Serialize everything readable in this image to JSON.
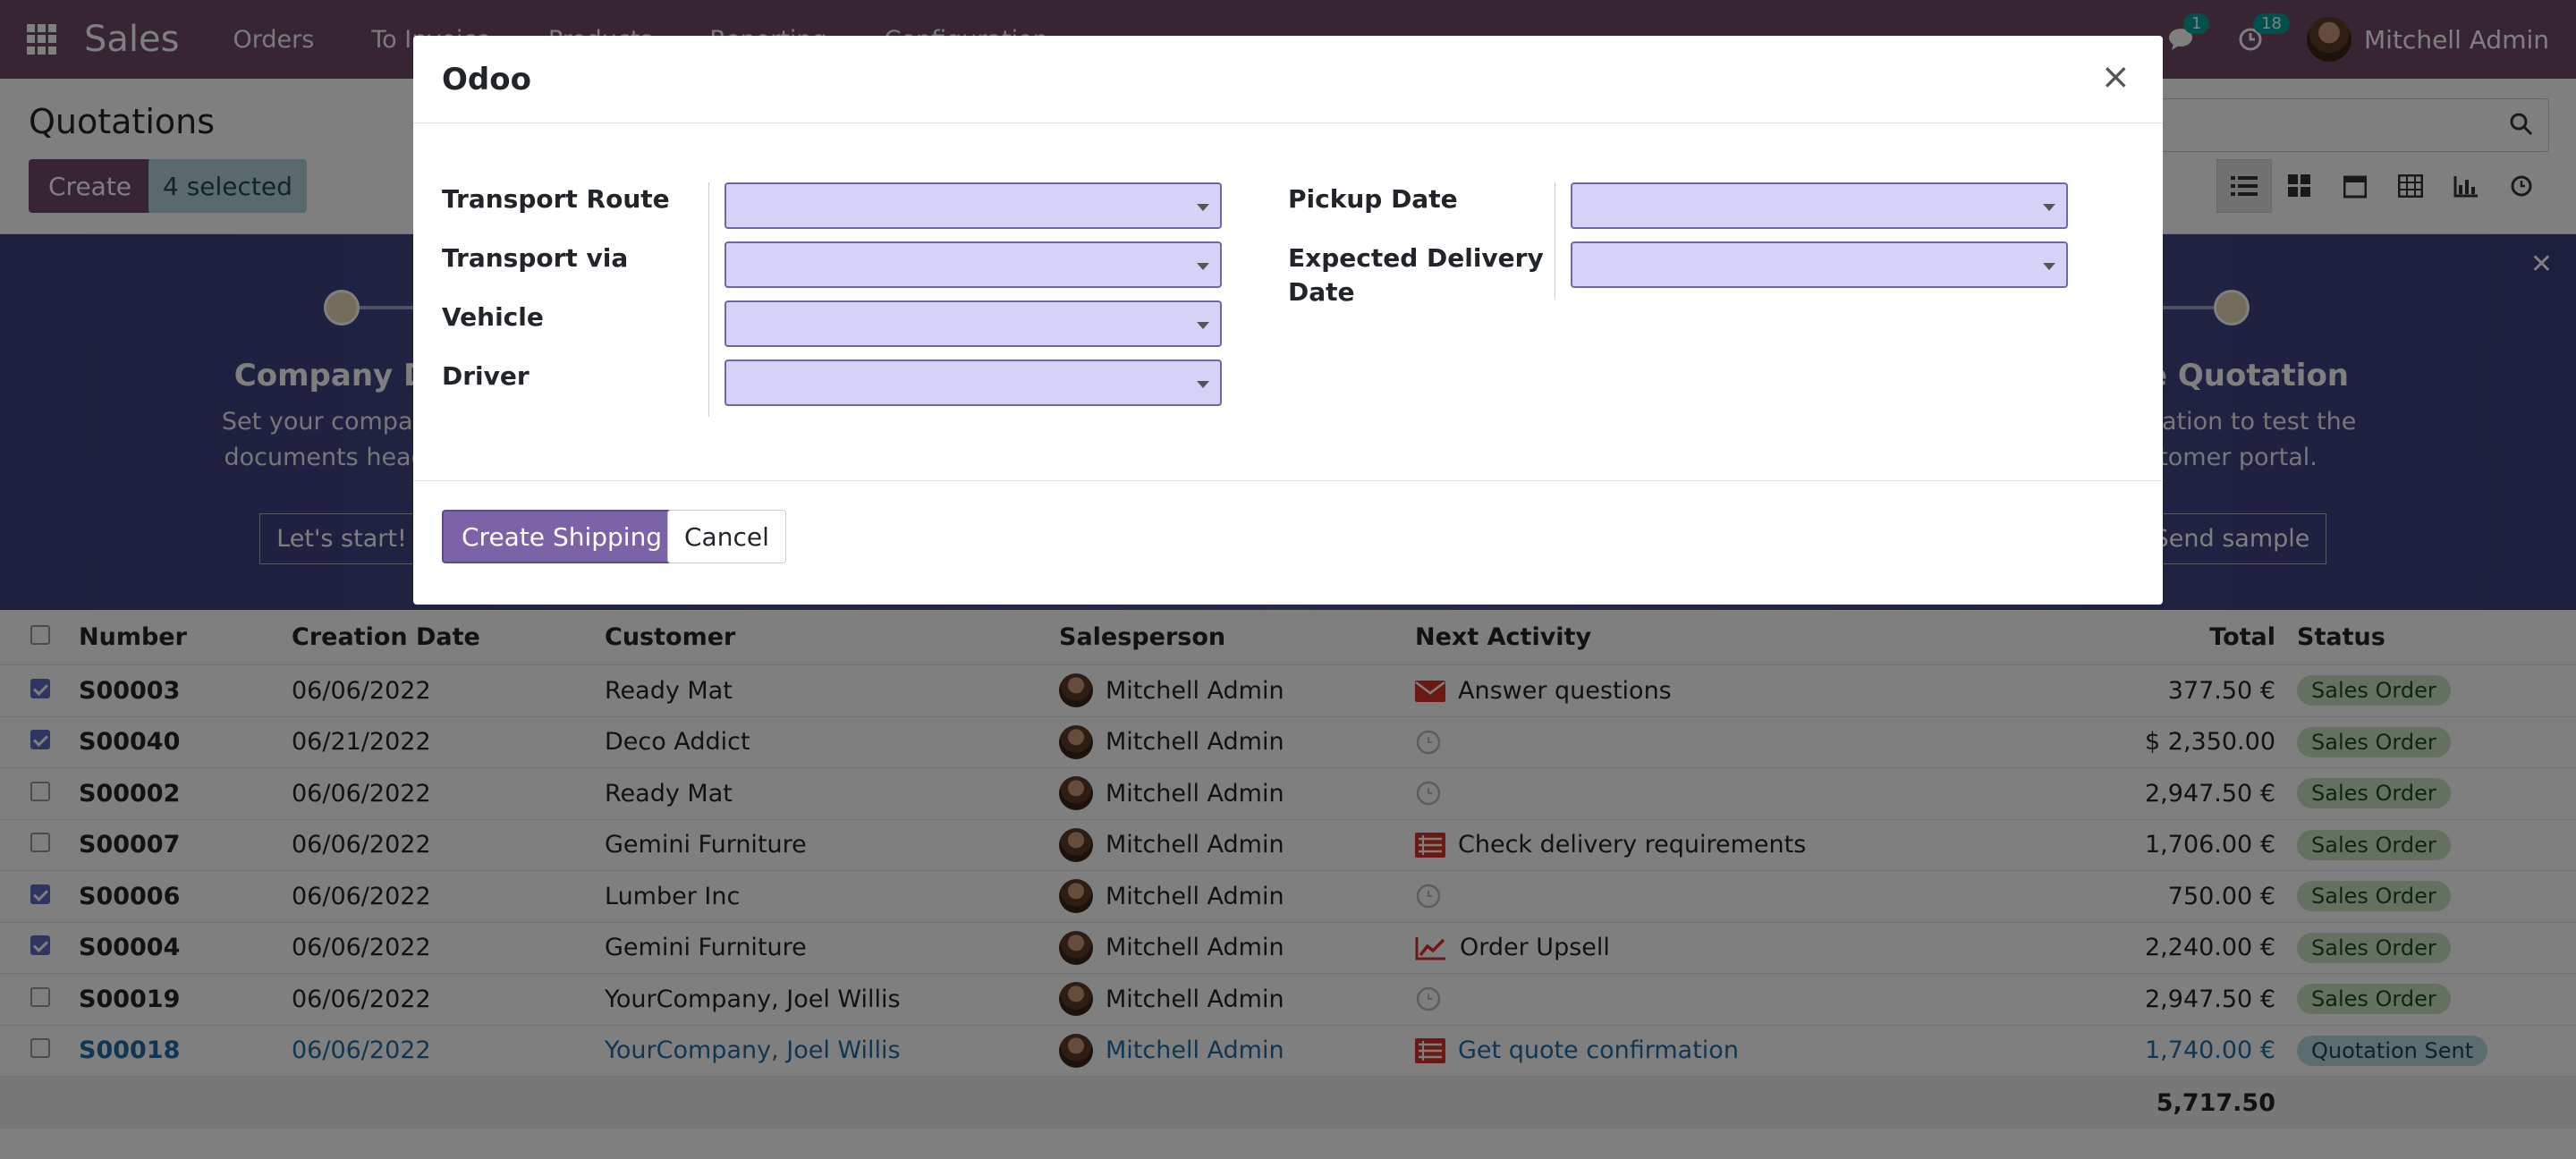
{
  "navbar": {
    "app_name": "Sales",
    "menu": [
      "Orders",
      "To Invoice",
      "Products",
      "Reporting",
      "Configuration"
    ],
    "messages_count": "1",
    "activities_count": "18",
    "user_name": "Mitchell Admin"
  },
  "control_panel": {
    "title": "Quotations",
    "create_label": "Create",
    "selected_label": "4 selected",
    "views": [
      "list-view-icon",
      "kanban-view-icon",
      "calendar-view-icon",
      "pivot-view-icon",
      "graph-view-icon",
      "activity-view-icon"
    ]
  },
  "banner": {
    "left_step": {
      "title": "Company Da",
      "text1": "Set your company's",
      "text2": "documents header/",
      "button": "Let's start!"
    },
    "right_step": {
      "title": "ple Quotation",
      "text1": "quotation to test the",
      "text2": "stomer portal.",
      "button": "Send sample"
    }
  },
  "table": {
    "headers": {
      "number": "Number",
      "creation_date": "Creation Date",
      "customer": "Customer",
      "salesperson": "Salesperson",
      "next_activity": "Next Activity",
      "total": "Total",
      "status": "Status"
    },
    "rows": [
      {
        "number": "S00003",
        "date": "06/06/2022",
        "customer": "Ready Mat",
        "salesperson": "Mitchell Admin",
        "activity": "Answer questions",
        "activity_icon": "envelope-icon",
        "total": "377.50 €",
        "status": "Sales Order",
        "checked": true
      },
      {
        "number": "S00040",
        "date": "06/21/2022",
        "customer": "Deco Addict",
        "salesperson": "Mitchell Admin",
        "activity": "",
        "activity_icon": "clock-icon",
        "total": "$ 2,350.00",
        "status": "Sales Order",
        "checked": true
      },
      {
        "number": "S00002",
        "date": "06/06/2022",
        "customer": "Ready Mat",
        "salesperson": "Mitchell Admin",
        "activity": "",
        "activity_icon": "clock-icon",
        "total": "2,947.50 €",
        "status": "Sales Order",
        "checked": false
      },
      {
        "number": "S00007",
        "date": "06/06/2022",
        "customer": "Gemini Furniture",
        "salesperson": "Mitchell Admin",
        "activity": "Check delivery requirements",
        "activity_icon": "todo-icon",
        "total": "1,706.00 €",
        "status": "Sales Order",
        "checked": false
      },
      {
        "number": "S00006",
        "date": "06/06/2022",
        "customer": "Lumber Inc",
        "salesperson": "Mitchell Admin",
        "activity": "",
        "activity_icon": "clock-icon",
        "total": "750.00 €",
        "status": "Sales Order",
        "checked": true
      },
      {
        "number": "S00004",
        "date": "06/06/2022",
        "customer": "Gemini Furniture",
        "salesperson": "Mitchell Admin",
        "activity": "Order Upsell",
        "activity_icon": "chart-up-icon",
        "total": "2,240.00 €",
        "status": "Sales Order",
        "checked": true
      },
      {
        "number": "S00019",
        "date": "06/06/2022",
        "customer": "YourCompany, Joel Willis",
        "salesperson": "Mitchell Admin",
        "activity": "",
        "activity_icon": "clock-icon",
        "total": "2,947.50 €",
        "status": "Sales Order",
        "checked": false
      },
      {
        "number": "S00018",
        "date": "06/06/2022",
        "customer": "YourCompany, Joel Willis",
        "salesperson": "Mitchell Admin",
        "activity": "Get quote confirmation",
        "activity_icon": "todo-icon",
        "total": "1,740.00 €",
        "status": "Quotation Sent",
        "checked": false
      }
    ],
    "sum_total": "5,717.50"
  },
  "dialog": {
    "title": "Odoo",
    "fields_left": [
      {
        "label": "Transport Route",
        "value": ""
      },
      {
        "label": "Transport via",
        "value": ""
      },
      {
        "label": "Vehicle",
        "value": ""
      },
      {
        "label": "Driver",
        "value": ""
      }
    ],
    "fields_right": [
      {
        "label": "Pickup Date",
        "value": ""
      },
      {
        "label": "Expected Delivery",
        "label2": "Date",
        "value": ""
      }
    ],
    "primary_button": "Create Shipping",
    "cancel_button": "Cancel"
  }
}
